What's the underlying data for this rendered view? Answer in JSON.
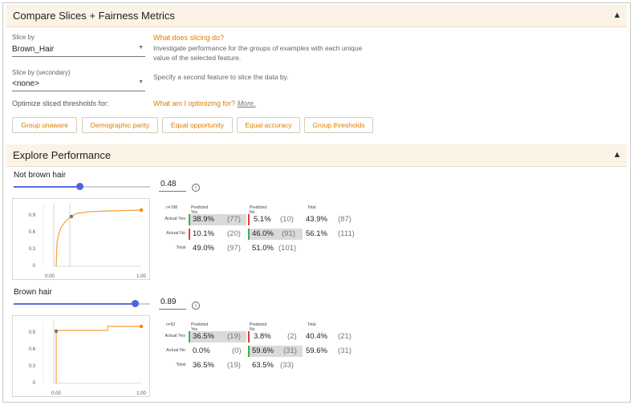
{
  "compare": {
    "title": "Compare Slices + Fairness Metrics",
    "slice_by_label": "Slice by",
    "slice_by_value": "Brown_Hair",
    "slice_help_title": "What does slicing do?",
    "slice_help_text1": "Investigate performance for the groups of examples with each unique",
    "slice_help_text2": "value of the selected feature.",
    "slice_by_secondary_label": "Slice by (secondary)",
    "slice_by_secondary_value": "<none>",
    "secondary_help": "Specify a second feature to slice the data by.",
    "optimize_label": "Optimize sliced thresholds for:",
    "optimize_help_title": "What am I optimizing for?",
    "more_link": "More.",
    "buttons": [
      "Group unaware",
      "Demographic parity",
      "Equal opportunity",
      "Equal accuracy",
      "Group thresholds"
    ]
  },
  "explore": {
    "title": "Explore Performance",
    "groups": [
      {
        "name": "Not brown hair",
        "slider_fraction": 0.48,
        "threshold": "0.48",
        "n": "n=198",
        "col_pred_yes": "Predicted Yes",
        "col_pred_no": "Predicted No",
        "col_total": "Total",
        "row_actual_yes": "Actual Yes",
        "row_actual_no": "Actual No",
        "row_total": "Total",
        "ay_py": "38.9%",
        "ay_py_n": "(77)",
        "ay_pn": "5.1%",
        "ay_pn_n": "(10)",
        "ay_t": "43.9%",
        "ay_t_n": "(87)",
        "an_py": "10.1%",
        "an_py_n": "(20)",
        "an_pn": "46.0%",
        "an_pn_n": "(91)",
        "an_t": "56.1%",
        "an_t_n": "(111)",
        "t_py": "49.0%",
        "t_py_n": "(97)",
        "t_pn": "51.0%",
        "t_pn_n": "(101)",
        "yticks": [
          "0.9",
          "0.6",
          "0.3",
          "0"
        ],
        "xticks": [
          "0.00",
          "1.00"
        ]
      },
      {
        "name": "Brown hair",
        "slider_fraction": 0.89,
        "threshold": "0.89",
        "n": "n=52",
        "col_pred_yes": "Predicted Yes",
        "col_pred_no": "Predicted No",
        "col_total": "Total",
        "row_actual_yes": "Actual Yes",
        "row_actual_no": "Actual No",
        "row_total": "Total",
        "ay_py": "36.5%",
        "ay_py_n": "(19)",
        "ay_pn": "3.8%",
        "ay_pn_n": "(2)",
        "ay_t": "40.4%",
        "ay_t_n": "(21)",
        "an_py": "0.0%",
        "an_py_n": "(0)",
        "an_pn": "59.6%",
        "an_pn_n": "(31)",
        "an_t": "59.6%",
        "an_t_n": "(31)",
        "t_py": "36.5%",
        "t_py_n": "(19)",
        "t_pn": "63.5%",
        "t_pn_n": "(33)",
        "yticks": [
          "0.9",
          "0.6",
          "0.3",
          "0"
        ],
        "xticks": [
          "0.00",
          "1.00"
        ]
      }
    ]
  },
  "colors": {
    "accent": "#e07b00",
    "header_bg": "#fbf3e6",
    "slider": "#4f63dd",
    "curve": "#f6a03a"
  },
  "icons": {
    "collapse": "chevron-up-icon",
    "dropdown": "caret-down-icon",
    "info": "info-icon"
  }
}
